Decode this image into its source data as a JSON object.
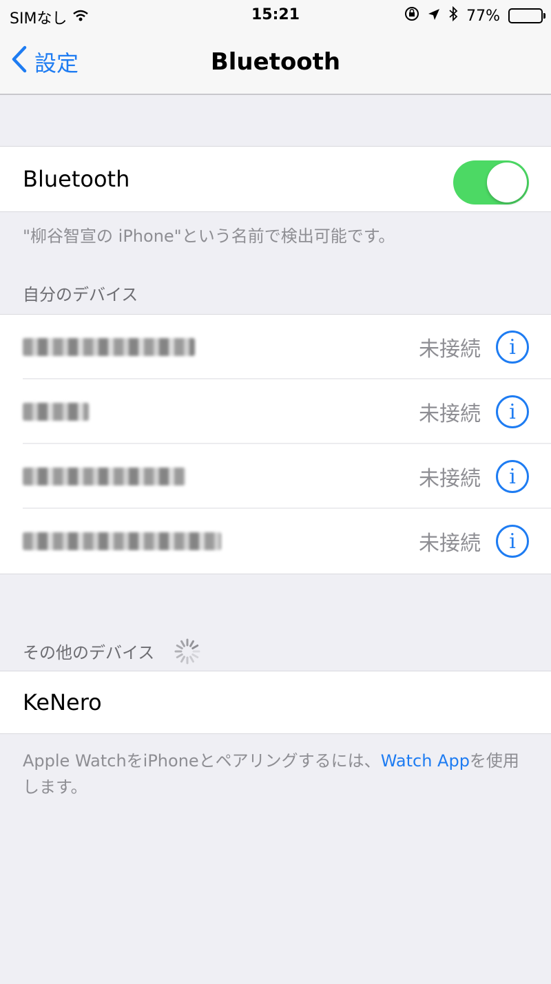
{
  "status_bar": {
    "carrier": "SIMなし",
    "time": "15:21",
    "battery": "77%",
    "battery_level": 0.77
  },
  "nav": {
    "back_label": "設定",
    "title": "Bluetooth"
  },
  "bluetooth": {
    "label": "Bluetooth",
    "enabled": true,
    "discoverable_note": "\"柳谷智宣の iPhone\"という名前で検出可能です。"
  },
  "my_devices": {
    "header": "自分のデバイス",
    "items": [
      {
        "status": "未接続"
      },
      {
        "status": "未接続"
      },
      {
        "status": "未接続"
      },
      {
        "status": "未接続"
      }
    ]
  },
  "other_devices": {
    "header": "その他のデバイス",
    "items": [
      {
        "name": "KeNero"
      }
    ]
  },
  "footer": {
    "text_before": "Apple WatchをiPhoneとペアリングするには、",
    "link": "Watch App",
    "text_after": "を使用します。"
  },
  "colors": {
    "accent": "#1e7cf2",
    "toggle_on": "#4cd964"
  }
}
